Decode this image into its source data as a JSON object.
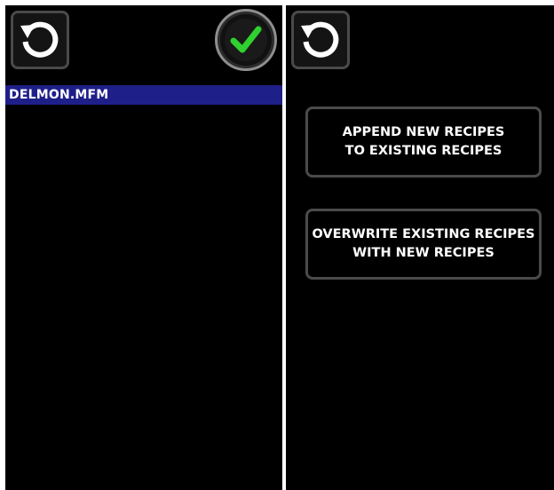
{
  "left_panel": {
    "back_icon": "refresh-back-icon",
    "confirm_icon": "green-check-icon",
    "files": [
      {
        "name": "DELMON.MFM",
        "selected": true
      }
    ]
  },
  "right_panel": {
    "back_icon": "refresh-back-icon",
    "append_button": {
      "line1": "APPEND NEW RECIPES",
      "line2": "TO EXISTING RECIPES"
    },
    "overwrite_button": {
      "line1": "OVERWRITE EXISTING RECIPES",
      "line2": "WITH NEW RECIPES"
    }
  },
  "colors": {
    "background": "#000000",
    "selected_row": "#1f1f8a",
    "check_green": "#2fd12f",
    "border": "#4a4a4a"
  }
}
